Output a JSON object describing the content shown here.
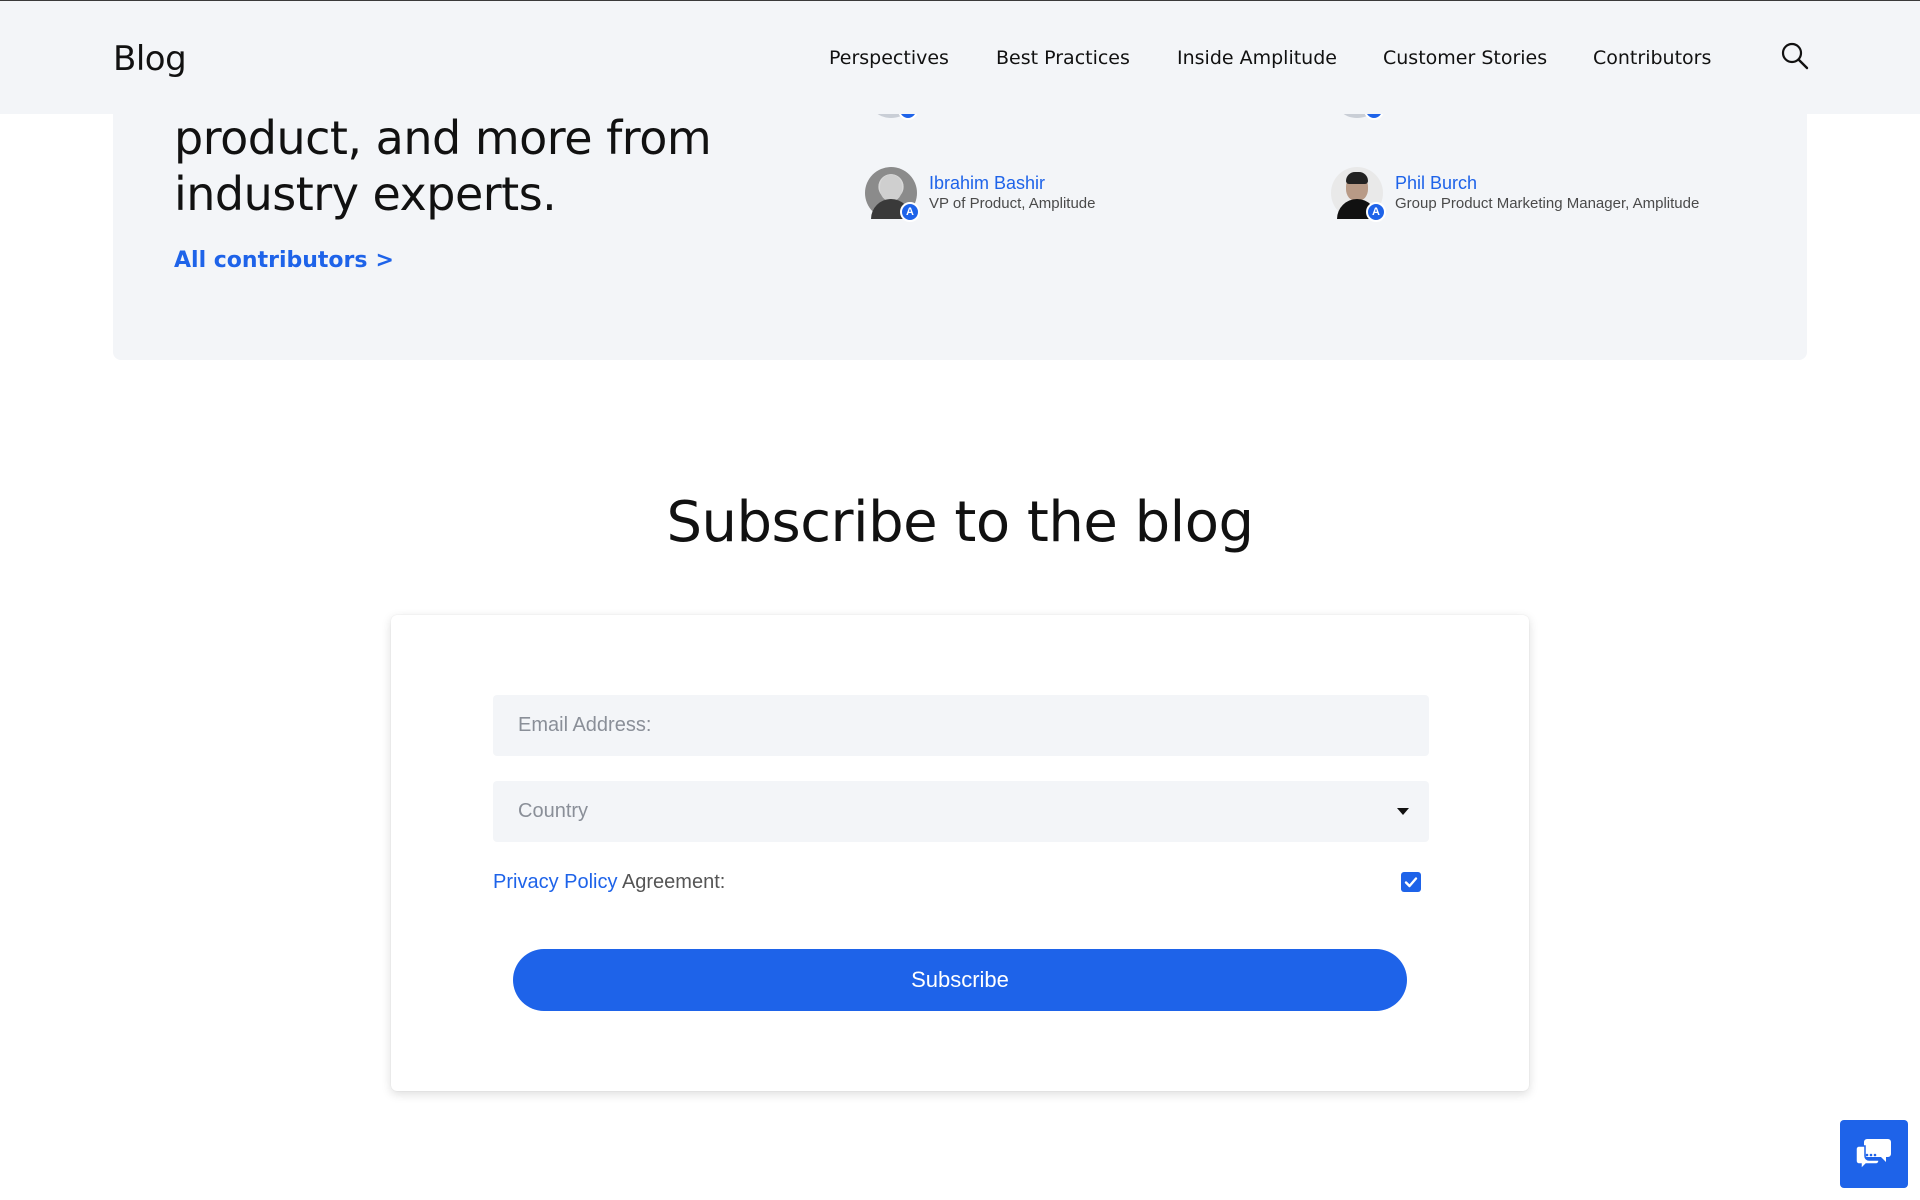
{
  "header": {
    "logo": "Blog",
    "nav": {
      "perspectives": "Perspectives",
      "best_practices": "Best Practices",
      "inside_amplitude": "Inside Amplitude",
      "customer_stories": "Customer Stories",
      "contributors": "Contributors"
    },
    "search_icon": "search-icon"
  },
  "contributors_section": {
    "heading_lines": [
      "product, and more from",
      "industry experts."
    ],
    "all_link": "All contributors",
    "all_link_chevron": ">",
    "people": [
      {
        "name": "Ibrahim Bashir",
        "role": "VP of Product, Amplitude"
      },
      {
        "name": "Phil Burch",
        "role": "Group Product Marketing Manager, Amplitude"
      }
    ],
    "badge_glyph": "A"
  },
  "subscribe": {
    "title": "Subscribe to the blog",
    "email_placeholder": "Email Address:",
    "country_placeholder": "Country",
    "privacy_link": "Privacy Policy",
    "privacy_suffix": " Agreement:",
    "agreement_checked": true,
    "button": "Subscribe"
  },
  "chat": {
    "icon": "chat-bubbles-icon"
  },
  "colors": {
    "accent": "#1e63e9",
    "panel_bg": "#f3f5f8",
    "text": "#111111"
  }
}
